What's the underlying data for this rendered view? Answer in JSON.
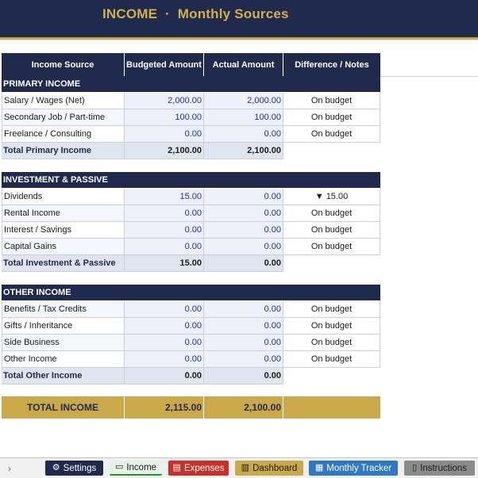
{
  "header": {
    "title": "INCOME  ·  Monthly Sources"
  },
  "table": {
    "columns": [
      "Income Source",
      "Budgeted Amount",
      "Actual Amount",
      "Difference / Notes"
    ],
    "sections": [
      {
        "title": "PRIMARY INCOME",
        "rows": [
          {
            "source": "Salary / Wages (Net)",
            "budgeted": "2,000.00",
            "actual": "2,000.00",
            "note": "On budget"
          },
          {
            "source": "Secondary Job / Part-time",
            "budgeted": "100.00",
            "actual": "100.00",
            "note": "On budget"
          },
          {
            "source": "Freelance / Consulting",
            "budgeted": "0.00",
            "actual": "0.00",
            "note": "On budget"
          }
        ],
        "total": {
          "label": "Total Primary Income",
          "budgeted": "2,100.00",
          "actual": "2,100.00"
        }
      },
      {
        "title": "INVESTMENT & PASSIVE",
        "rows": [
          {
            "source": "Dividends",
            "budgeted": "15.00",
            "actual": "0.00",
            "note": "▼ 15.00"
          },
          {
            "source": "Rental Income",
            "budgeted": "0.00",
            "actual": "0.00",
            "note": "On budget"
          },
          {
            "source": "Interest / Savings",
            "budgeted": "0.00",
            "actual": "0.00",
            "note": "On budget"
          },
          {
            "source": "Capital Gains",
            "budgeted": "0.00",
            "actual": "0.00",
            "note": "On budget"
          }
        ],
        "total": {
          "label": "Total Investment & Passive",
          "budgeted": "15.00",
          "actual": "0.00"
        }
      },
      {
        "title": "OTHER INCOME",
        "rows": [
          {
            "source": "Benefits / Tax Credits",
            "budgeted": "0.00",
            "actual": "0.00",
            "note": "On budget"
          },
          {
            "source": "Gifts / Inheritance",
            "budgeted": "0.00",
            "actual": "0.00",
            "note": "On budget"
          },
          {
            "source": "Side Business",
            "budgeted": "0.00",
            "actual": "0.00",
            "note": "On budget"
          },
          {
            "source": "Other Income",
            "budgeted": "0.00",
            "actual": "0.00",
            "note": "On budget"
          }
        ],
        "total": {
          "label": "Total Other Income",
          "budgeted": "0.00",
          "actual": "0.00"
        }
      }
    ],
    "grand_total": {
      "label": "TOTAL INCOME",
      "budgeted": "2,115.00",
      "actual": "2,100.00"
    }
  },
  "tabs": [
    {
      "label": "Settings",
      "icon": "gear-icon",
      "glyph": "⚙"
    },
    {
      "label": "Income",
      "icon": "cash-stack-icon",
      "glyph": "▭"
    },
    {
      "label": "Expenses",
      "icon": "receipt-icon",
      "glyph": "▤"
    },
    {
      "label": "Dashboard",
      "icon": "bar-chart-icon",
      "glyph": "▥"
    },
    {
      "label": "Monthly Tracker",
      "icon": "calendar-icon",
      "glyph": "▦"
    },
    {
      "label": "Instructions",
      "icon": "book-icon",
      "glyph": "▯"
    }
  ],
  "tab_nav": {
    "glyph": "›"
  },
  "colors": {
    "navy": "#1f2a4d",
    "gold": "#c9a94a",
    "amount_blue": "#1c2fa8",
    "expenses_red": "#c8312b",
    "tracker_blue": "#2f78c4",
    "income_green": "#2e8b3a"
  }
}
